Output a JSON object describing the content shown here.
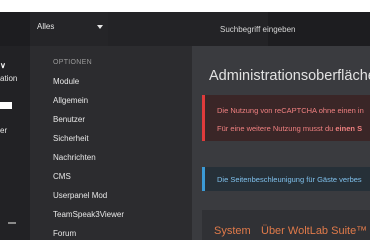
{
  "search": {
    "scope_label": "Alles",
    "placeholder": "Suchbegriff eingeben"
  },
  "leftcol": {
    "item1": "ation",
    "item2": "er"
  },
  "menu": {
    "header": "OPTIONEN",
    "items": [
      "Module",
      "Allgemein",
      "Benutzer",
      "Sicherheit",
      "Nachrichten",
      "CMS",
      "Userpanel Mod",
      "TeamSpeak3Viewer",
      "Forum"
    ]
  },
  "main": {
    "title": "Administrationsoberfläche",
    "alert_red": {
      "line1": "Die Nutzung von reCAPTCHA ohne einen in",
      "line2_prefix": "Für eine weitere Nutzung musst du ",
      "line2_bold": "einen S"
    },
    "alert_blue": {
      "line1": "Die Seitenbeschleunigung für Gäste verbes"
    },
    "system": {
      "title": "System",
      "subtitle": "Über WoltLab Suite™"
    }
  },
  "colors": {
    "accent_orange": "#e07a4a",
    "error_red": "#e03b3b",
    "info_blue": "#3b9ad6"
  }
}
